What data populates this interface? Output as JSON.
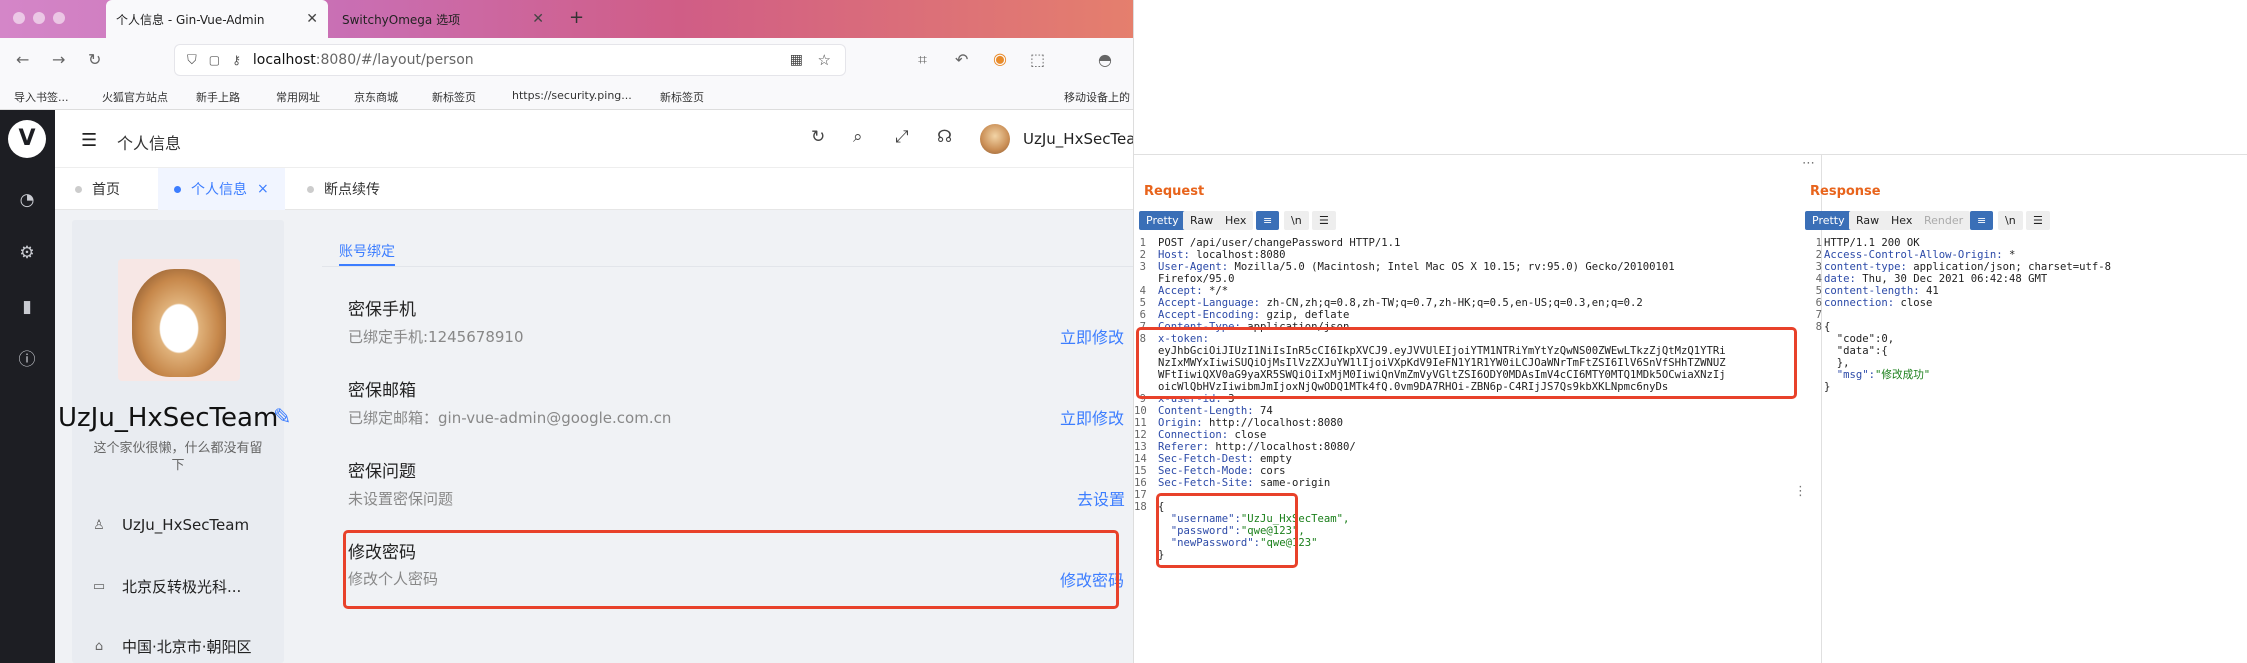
{
  "browser": {
    "tabs": [
      {
        "label": "个人信息 - Gin-Vue-Admin",
        "active": true
      },
      {
        "label": "SwitchyOmega 选项",
        "active": false
      }
    ],
    "new_tab": "+",
    "url_host": "localhost",
    "url_rest": ":8080/#/layout/person",
    "bookmarks": [
      "导入书签...",
      "火狐官方站点",
      "新手上路",
      "常用网址",
      "京东商城",
      "新标签页",
      "https://security.ping...",
      "新标签页",
      "移动设备上的"
    ]
  },
  "app": {
    "title": "个人信息",
    "user": "UzJu_HxSecTeam",
    "tags": [
      {
        "label": "首页",
        "active": false
      },
      {
        "label": "个人信息",
        "active": true
      },
      {
        "label": "断点续传",
        "active": false
      }
    ],
    "profile": {
      "name": "UzJu_HxSecTeam",
      "bio": "这个家伙很懒，什么都没有留下",
      "info": [
        {
          "icon": "user-icon",
          "text": "UzJu_HxSecTeam"
        },
        {
          "icon": "company-icon",
          "text": "北京反转极光科..."
        },
        {
          "icon": "location-icon",
          "text": "中国·北京市·朝阳区"
        }
      ]
    },
    "account_tab": "账号绑定",
    "sections": [
      {
        "title": "密保手机",
        "desc": "已绑定手机:1245678910",
        "action": "立即修改"
      },
      {
        "title": "密保邮箱",
        "desc": "已绑定邮箱：gin-vue-admin@google.com.cn",
        "action": "立即修改"
      },
      {
        "title": "密保问题",
        "desc": "未设置密保问题",
        "action": "去设置"
      },
      {
        "title": "修改密码",
        "desc": "修改个人密码",
        "action": "修改密码"
      }
    ]
  },
  "burp": {
    "request_title": "Request",
    "response_title": "Response",
    "request_tabs": [
      "Pretty",
      "Raw",
      "Hex"
    ],
    "response_tabs": [
      "Pretty",
      "Raw",
      "Hex",
      "Render"
    ],
    "wrap_icons": [
      "≡",
      "\\n",
      "☰"
    ],
    "request_lines": [
      "POST /api/user/changePassword HTTP/1.1",
      "Host: localhost:8080",
      "User-Agent: Mozilla/5.0 (Macintosh; Intel Mac OS X 10.15; rv:95.0) Gecko/20100101",
      "Firefox/95.0",
      "Accept: */*",
      "Accept-Language: zh-CN,zh;q=0.8,zh-TW;q=0.7,zh-HK;q=0.5,en-US;q=0.3,en;q=0.2",
      "Accept-Encoding: gzip, deflate",
      "Content-Type: application/json",
      "x-token:",
      "eyJhbGciOiJIUzI1NiIsInR5cCI6IkpXVCJ9.eyJVVUlEIjoiYTM1NTRiYmYtYzQwNS00ZWEwLTkzZjQtMzQ1YTRi",
      "NzIxMWYxIiwiSUQiOjMsIlVzZXJuYW1lIjoiVXpKdV9IeFN1Y1R1YW0iLCJOaWNrTmFtZSI6IlV6SnVfSHhTZWNUZ",
      "WFtIiwiQXV0aG9yaXR5SWQiOiIxMjM0IiwiQnVmZmVyVGltZSI6ODY0MDAsImV4cCI6MTY0MTQ1MDk5OCwiaXNzIj",
      "oicWlQbHVzIiwibmJmIjoxNjQwODQ1MTk4fQ.0vm9DA7RHOi-ZBN6p-C4RIjJS7Qs9kbXKLNpmc6nyDs",
      "x-user-id: 3",
      "Content-Length: 74",
      "Origin: http://localhost:8080",
      "Connection: close",
      "Referer: http://localhost:8080/",
      "Sec-Fetch-Dest: empty",
      "Sec-Fetch-Mode: cors",
      "Sec-Fetch-Site: same-origin",
      "",
      "{",
      "  \"username\":\"UzJu_HxSecTeam\",",
      "  \"password\":\"qwe@123\",",
      "  \"newPassword\":\"qwe@123\"",
      "}"
    ],
    "request_line_numbers": [
      "1",
      "2",
      "3",
      "",
      "4",
      "5",
      "6",
      "7",
      "8",
      "",
      "",
      "",
      "",
      "9",
      "10",
      "11",
      "12",
      "13",
      "14",
      "15",
      "16",
      "17",
      "18",
      "",
      "",
      "",
      ""
    ],
    "response_lines": [
      "HTTP/1.1 200 OK",
      "Access-Control-Allow-Origin: *",
      "content-type: application/json; charset=utf-8",
      "date: Thu, 30 Dec 2021 06:42:48 GMT",
      "content-length: 41",
      "connection: close",
      "",
      "{",
      "  \"code\":0,",
      "  \"data\":{",
      "  },",
      "  \"msg\":\"修改成功\"",
      "}"
    ],
    "response_line_numbers": [
      "1",
      "2",
      "3",
      "4",
      "5",
      "6",
      "7",
      "8",
      "",
      "",
      "",
      "",
      ""
    ]
  }
}
